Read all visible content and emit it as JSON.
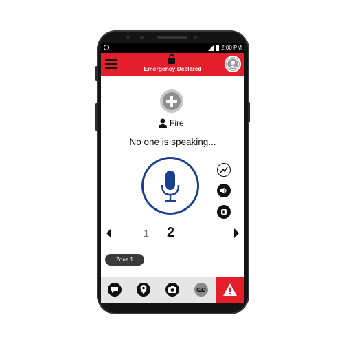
{
  "status_bar": {
    "time": "2:00 PM",
    "icons": [
      "settings-circle-icon",
      "signal-icon",
      "battery-icon"
    ]
  },
  "app_bar": {
    "title": "Emergency Declared",
    "icons": [
      "menu-icon",
      "unlock-icon",
      "user-avatar-icon"
    ]
  },
  "main": {
    "channel": {
      "icon": "person-icon",
      "name": "Fire"
    },
    "speaking_status": "No one is speaking...",
    "ptt_icon": "microphone-icon",
    "side_actions": [
      "signal-strength-icon",
      "volume-icon",
      "record-icon"
    ],
    "pager": {
      "pages": [
        "1",
        "2"
      ],
      "current": "2"
    },
    "zone_label": "Zone 1"
  },
  "bottom_tabs": {
    "icons": [
      "chat-icon",
      "location-icon",
      "camera-icon",
      "voicemail-icon",
      "alert-icon"
    ]
  },
  "colors": {
    "accent_red": "#e41e2b",
    "ptt_blue": "#1a3f91",
    "dark": "#111111"
  }
}
